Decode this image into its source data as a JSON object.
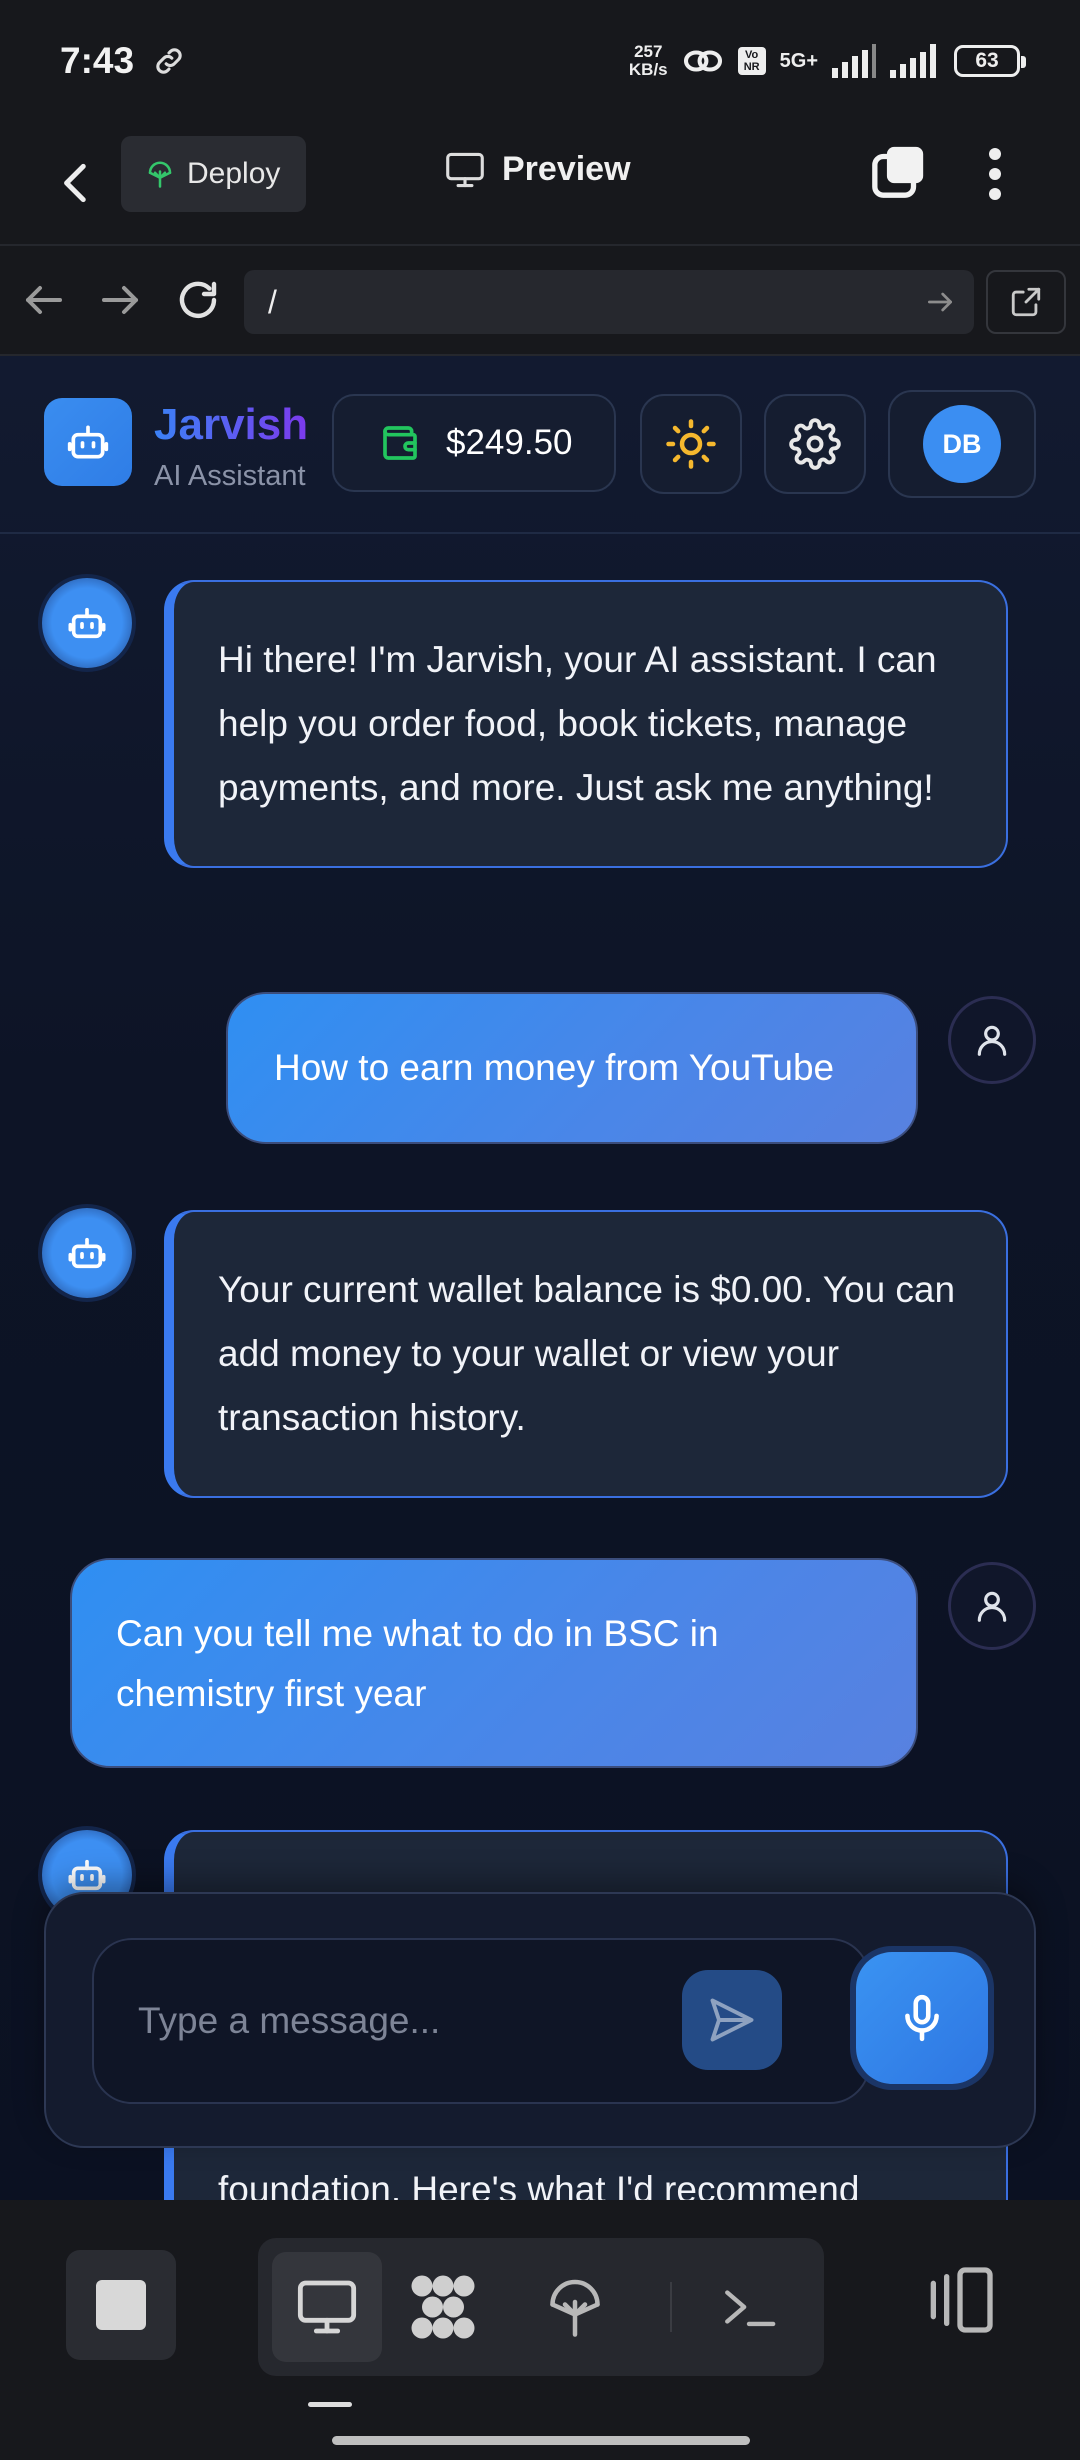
{
  "status_bar": {
    "time": "7:43",
    "net_speed_value": "257",
    "net_speed_unit": "KB/s",
    "network": "5G+",
    "volte": "Vo NR",
    "battery": "63"
  },
  "toolbar": {
    "deploy_label": "Deploy",
    "preview_label": "Preview"
  },
  "address_bar": {
    "url": "/"
  },
  "app": {
    "brand_name": "Jarvish",
    "brand_subtitle": "AI Assistant",
    "wallet_balance": "$249.50",
    "avatar_initials": "DB",
    "colors": {
      "accent": "#3b8ef2",
      "wallet_icon": "#22c55e",
      "theme_icon": "#f5b82e"
    }
  },
  "chat": {
    "messages": [
      {
        "role": "assistant",
        "text": "Hi there! I'm Jarvish, your AI assistant. I can help you order food, book tickets, manage payments, and more. Just ask me anything!"
      },
      {
        "role": "user",
        "text": "How to earn money from YouTube"
      },
      {
        "role": "assistant",
        "text": "Your current wallet balance is $0.00. You can add money to your wallet or view your transaction history."
      },
      {
        "role": "user",
        "text": "Can you tell me what to do in BSC in chemistry first year"
      },
      {
        "role": "assistant",
        "text": "foundation. Here's what I'd recommend"
      }
    ]
  },
  "composer": {
    "placeholder": "Type a message..."
  },
  "dock": {
    "icons": [
      "stop-icon",
      "monitor-icon",
      "apps-icon",
      "deploy-icon",
      "terminal-icon",
      "layout-toggle-icon"
    ]
  }
}
